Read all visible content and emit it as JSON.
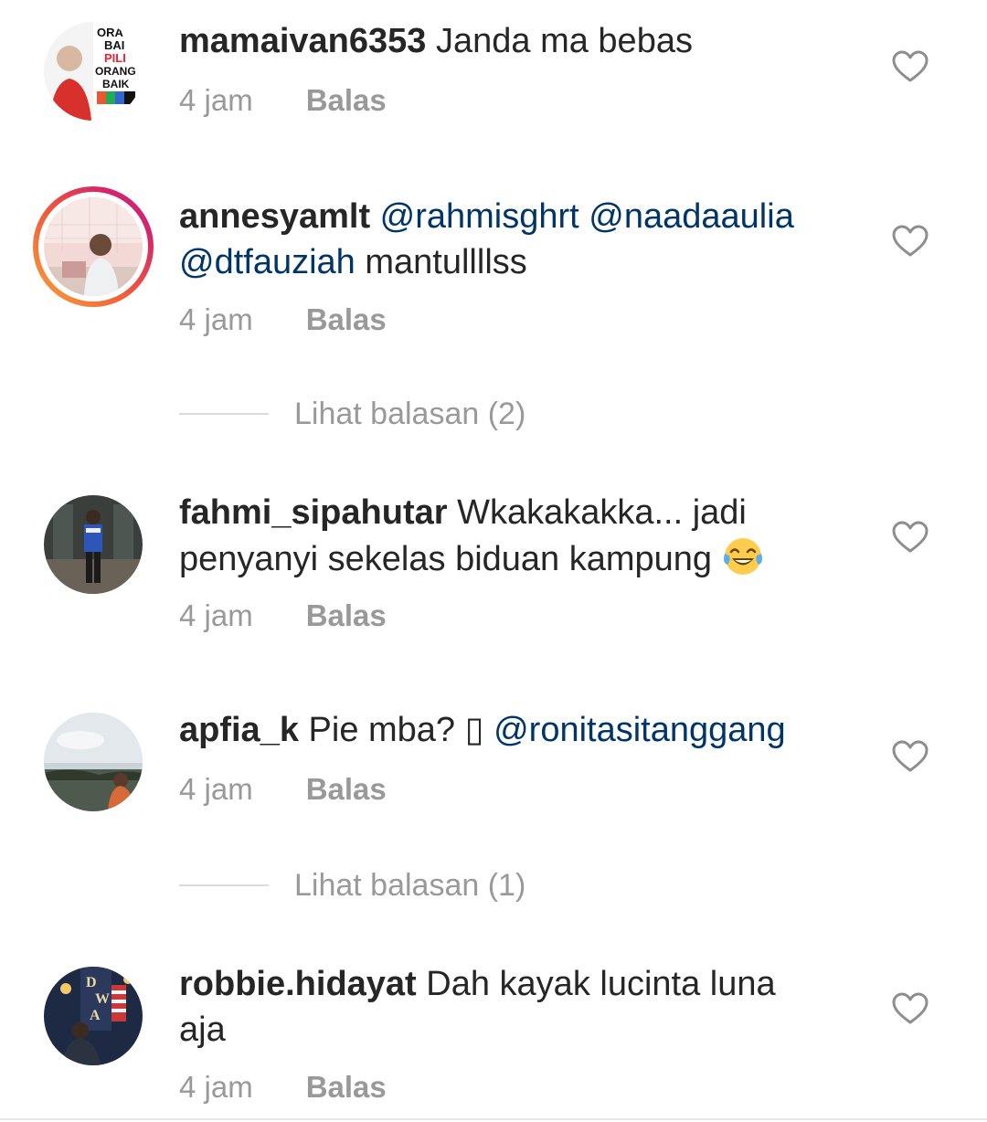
{
  "comments": [
    {
      "username": "mamaivan6353",
      "text": "Janda ma bebas",
      "time": "4 jam",
      "reply": "Balas"
    },
    {
      "username": "annesyamlt",
      "mentions": [
        "@rahmisghrt",
        "@naadaaulia",
        "@dtfauziah"
      ],
      "text": "mantullllss",
      "time": "4 jam",
      "reply": "Balas",
      "view_replies": "Lihat balasan (2)"
    },
    {
      "username": "fahmi_sipahutar",
      "text_line1": "Wkakakakka... jadi",
      "text_line2": "penyanyi sekelas biduan kampung",
      "emoji": "face-with-tears-of-joy",
      "time": "4 jam",
      "reply": "Balas"
    },
    {
      "username": "apfia_k",
      "text": "Pie mba? ▯",
      "mention": "@ronitasitanggang",
      "time": "4 jam",
      "reply": "Balas",
      "view_replies": "Lihat balasan (1)"
    },
    {
      "username": "robbie.hidayat",
      "text_line1": "Dah kayak lucinta luna",
      "text_line2": "aja",
      "time": "4 jam",
      "reply": "Balas"
    }
  ],
  "colors": {
    "username": "#262626",
    "mention": "#003569",
    "meta": "#999999"
  },
  "icons": {
    "like": "heart-outline-icon"
  }
}
